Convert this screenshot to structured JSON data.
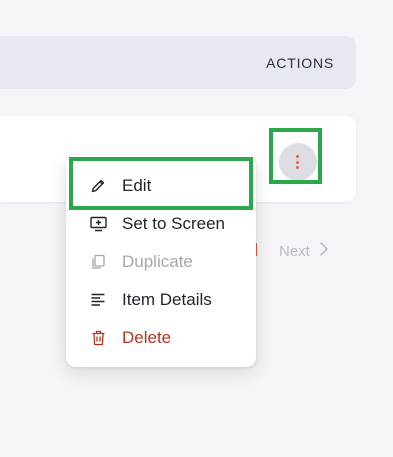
{
  "table": {
    "actions_header": "ACTIONS"
  },
  "pagination": {
    "next_label": "Next",
    "next_icon": "chevron-right-icon"
  },
  "menu": {
    "items": [
      {
        "label": "Edit",
        "icon": "pencil-icon",
        "state": "normal"
      },
      {
        "label": "Set to Screen",
        "icon": "monitor-plus-icon",
        "state": "normal"
      },
      {
        "label": "Duplicate",
        "icon": "duplicate-icon",
        "state": "disabled"
      },
      {
        "label": "Item Details",
        "icon": "details-lines-icon",
        "state": "normal"
      },
      {
        "label": "Delete",
        "icon": "trash-icon",
        "state": "danger"
      }
    ]
  },
  "colors": {
    "highlight": "#2aa84a",
    "danger": "#b3341f",
    "kebab_dots": "#e2683a"
  }
}
